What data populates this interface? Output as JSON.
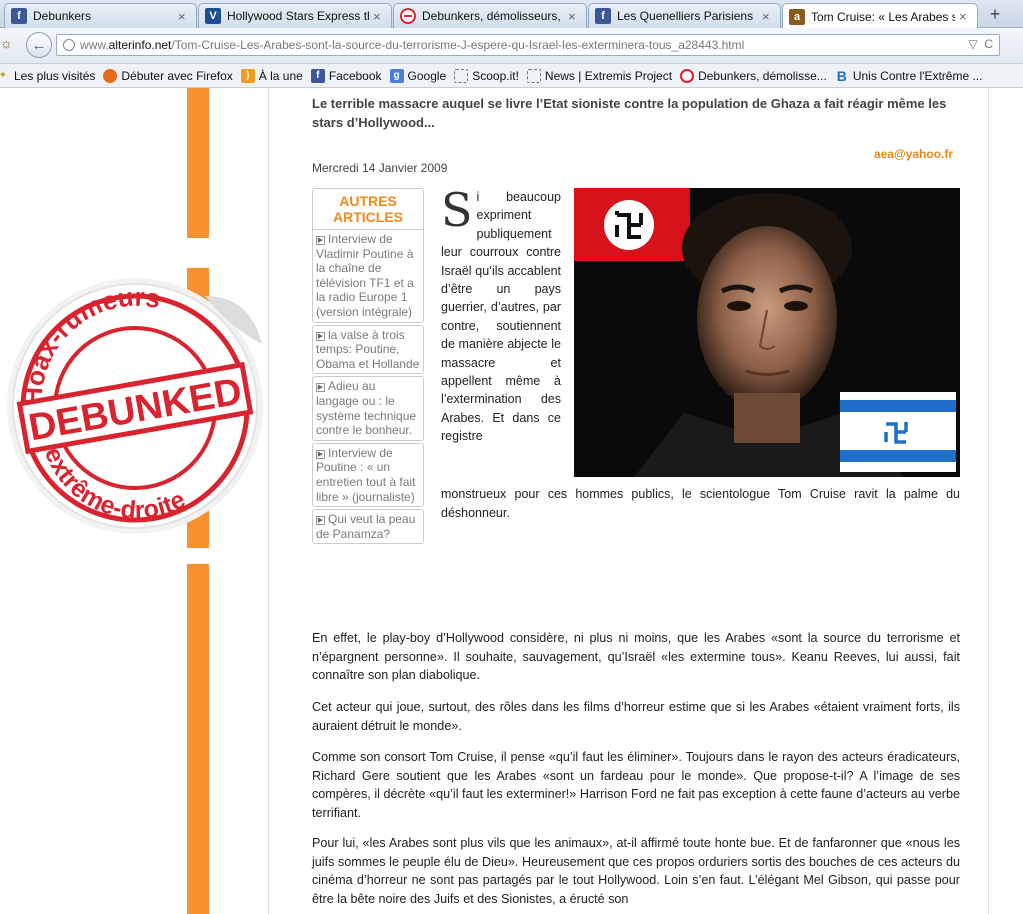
{
  "tabs": [
    {
      "label": "Debunkers",
      "icon": "facebook-icon",
      "active": false
    },
    {
      "label": "Hollywood Stars Express th...",
      "icon": "vimeo-icon",
      "active": false
    },
    {
      "label": "Debunkers, démolisseurs, ...",
      "icon": "no-entry-icon",
      "active": false
    },
    {
      "label": "Les Quenelliers Parisiens",
      "icon": "facebook-icon",
      "active": false
    },
    {
      "label": "Tom Cruise: « Les Arabes s...",
      "icon": "alterinfo-icon",
      "active": true
    }
  ],
  "new_tab_label": "+",
  "tab_close": "×",
  "url": {
    "prefix": "www.",
    "host": "alterinfo.net",
    "path": "/Tom-Cruise-Les-Arabes-sont-la-source-du-terrorisme-J-espere-qu-Israel-les-exterminera-tous_a28443.html",
    "dropdown": "▽",
    "reload": "C"
  },
  "bookmarks": [
    {
      "label": "Les plus visités",
      "icon": "star-icon"
    },
    {
      "label": "Débuter avec Firefox",
      "icon": "firefox-icon"
    },
    {
      "label": "À la une",
      "icon": "rss-icon"
    },
    {
      "label": "Facebook",
      "icon": "facebook-icon"
    },
    {
      "label": "Google",
      "icon": "google-icon"
    },
    {
      "label": "Scoop.it!",
      "icon": "page-icon"
    },
    {
      "label": "News | Extremis Project",
      "icon": "page-icon"
    },
    {
      "label": "Debunkers, démolisse...",
      "icon": "no-entry-icon"
    },
    {
      "label": "Unis Contre l'Extrême ...",
      "icon": "b-icon"
    }
  ],
  "article": {
    "subtitle": "Le terrible massacre auquel se livre l’Etat sioniste contre la population de Ghaza a fait réagir même les stars d’Hollywood...",
    "email": "aea@yahoo.fr",
    "date": "Mercredi 14 Janvier 2009",
    "dropcap": "S",
    "intro": "i beaucoup expriment publiquement leur courroux contre Israël qu’ils accablent d’être un pays guerrier, d’autres, par contre, soutiennent de manière abjecte le massacre et appellent même à l’extermination des Arabes. Et dans ce registre",
    "intro_tail": "monstrueux pour ces hommes publics, le scientologue Tom Cruise ravit la palme du déshonneur.",
    "paragraphs": [
      "En effet, le play-boy d’Hollywood considère, ni plus ni moins, que les Arabes «sont la source du terrorisme et n’épargnent personne». Il souhaite, sauvagement, qu’Israël «les extermine tous». Keanu Reeves, lui aussi, fait connaître son plan diabolique.",
      "Cet acteur qui joue, surtout, des rôles dans les films d’horreur estime que si les Arabes «étaient vraiment forts, ils auraient détruit le monde».",
      "Comme son consort Tom Cruise, il pense «qu’il faut les éliminer». Toujours dans le rayon des acteurs éradicateurs, Richard Gere soutient que les Arabes «sont un fardeau pour le monde». Que propose-t-il? A l’image de ses compères, il décrète «qu’il faut les exterminer!» Harrison Ford ne fait pas exception à cette faune d’acteurs au verbe terrifiant.",
      "Pour lui, «les Arabes sont plus vils que les animaux», at-il affirmé toute honte bue. Et de fanfaronner que «nous les juifs sommes le peuple élu de Dieu». Heureusement que ces propos orduriers sortis des bouches de ces acteurs du cinéma d’horreur ne sont pas partagés par le tout Hollywood. Loin s’en faut. L’élégant Mel Gibson, qui passe pour être la bête noire des Juifs et des Sionistes, a éructé son"
    ]
  },
  "other_articles": {
    "heading": "AUTRES ARTICLES",
    "items": [
      "Interview de Vladimir Poutine à la chaîne de télévision TF1 et a la radio Europe 1 (version intégrale)",
      "la valse à trois temps: Poutine, Obama et Hollande",
      "Adieu au langage ou : le système technique contre le bonheur.",
      "Interview de Poutine : « un entretien tout à fait libre » (journaliste)",
      "Qui veut la peau de Panamza?"
    ]
  },
  "sticker": {
    "top_text": "Hoax-rumeurs",
    "center_text": "DEBUNKED",
    "bottom_text": "d'extrême-droite",
    "color": "#d9232e"
  },
  "colors": {
    "accent_orange": "#f7912d",
    "link_orange": "#e5891a",
    "text": "#222222"
  }
}
